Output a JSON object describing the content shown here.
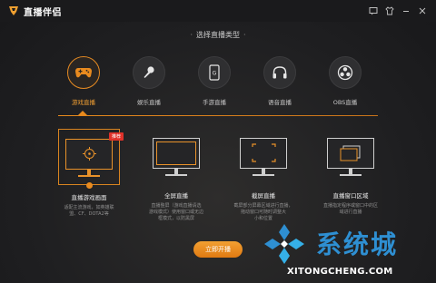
{
  "app": {
    "title": "直播伴侣"
  },
  "window_controls": [
    {
      "name": "feedback-icon",
      "glyph": "⌨"
    },
    {
      "name": "skin-icon",
      "glyph": "👕"
    },
    {
      "name": "minimize-icon",
      "glyph": "—"
    },
    {
      "name": "close-icon",
      "glyph": "✕"
    }
  ],
  "header": {
    "section_title": "选择直播类型"
  },
  "modes": [
    {
      "label": "游戏直播",
      "icon": "gamepad-icon",
      "active": true
    },
    {
      "label": "娱乐直播",
      "icon": "microphone-icon",
      "active": false
    },
    {
      "label": "手游直播",
      "icon": "phone-icon",
      "active": false
    },
    {
      "label": "语音直播",
      "icon": "headphones-icon",
      "active": false
    },
    {
      "label": "OBS直播",
      "icon": "obs-icon",
      "active": false
    }
  ],
  "cards": [
    {
      "title": "直播游戏画面",
      "desc1": "适配主流游戏，如英雄联",
      "desc2": "盟、CF、DOTA2等",
      "badge": "推荐",
      "active": true
    },
    {
      "title": "全屏直播",
      "desc1": "直播整屏（游戏直播请选",
      "desc2": "游戏模式）使用窗口或无边",
      "desc3": "框模式，以防黑屏",
      "active": false
    },
    {
      "title": "截屏直播",
      "desc1": "截屏部分屏幕区域进行直播，",
      "desc2": "拖动窗口可随时调整大",
      "desc3": "小和位置",
      "active": false
    },
    {
      "title": "直播窗口区域",
      "desc1": "直播指定程序或窗口中的区",
      "desc2": "域进行直播",
      "active": false
    }
  ],
  "start_button": {
    "label": "立即开播"
  },
  "watermark": {
    "cn": "系统城",
    "en": "XITONGCHENG.COM"
  },
  "colors": {
    "accent": "#e98b1f",
    "badge": "#e0322a",
    "watermark_blue": "#2e8fd2"
  }
}
